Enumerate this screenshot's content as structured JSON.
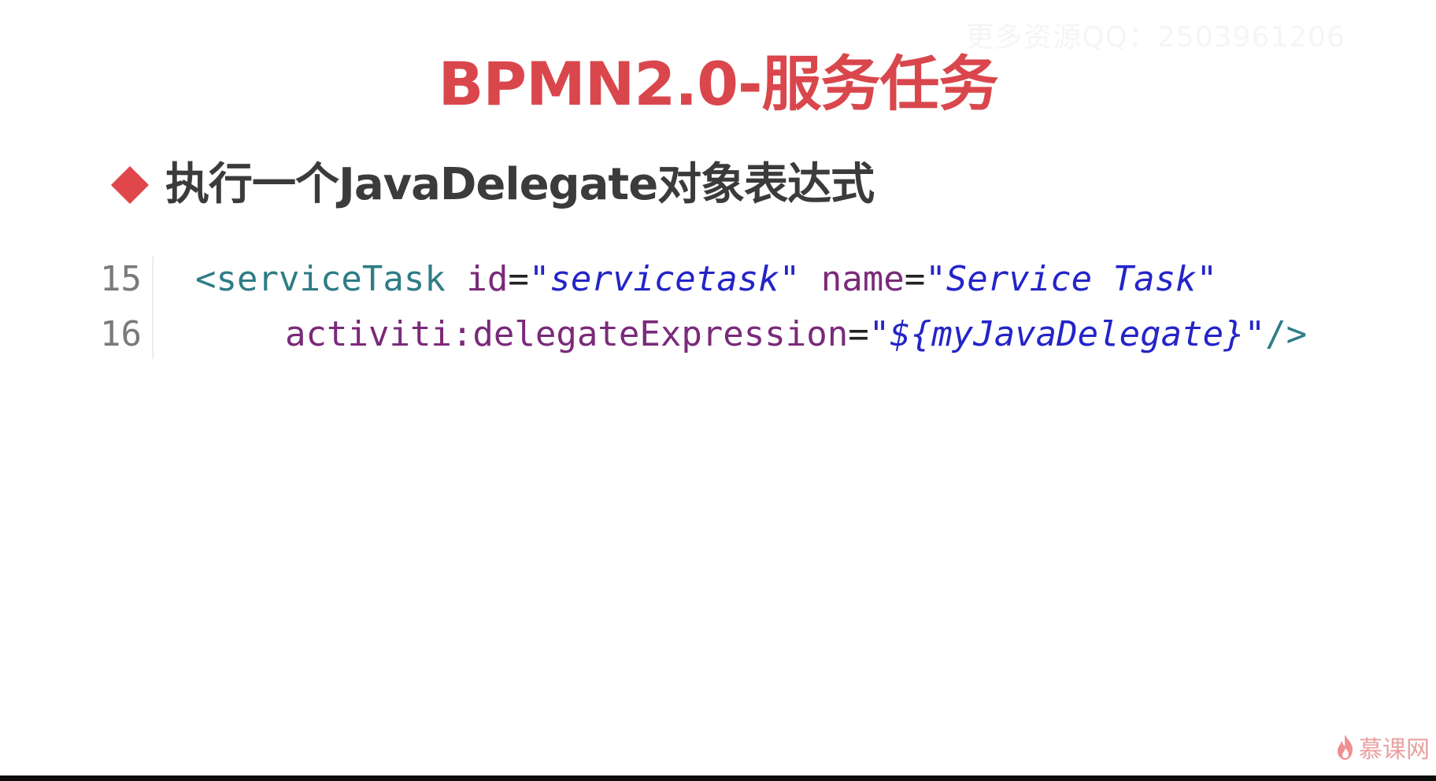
{
  "watermark": "更多资源QQ：2503961206",
  "title": "BPMN2.0-服务任务",
  "subtitle": "执行一个JavaDelegate对象表达式",
  "code": {
    "line1": {
      "number": "15",
      "tag_open": "<serviceTask",
      "attr1": "id",
      "eq1": "=",
      "val1": "\"servicetask\"",
      "attr2": "name",
      "eq2": "=",
      "val2": "\"Service Task\""
    },
    "line2": {
      "number": "16",
      "attr": "activiti:delegateExpression",
      "eq": "=",
      "val": "\"${myJavaDelegate}\"",
      "tag_close": "/>"
    }
  },
  "logo": {
    "icon": "flame-icon",
    "text": "慕课网"
  },
  "colors": {
    "title": "#d9474c",
    "bullet": "#e0474c",
    "subtitle": "#3b3b3b",
    "tag": "#2e7d86",
    "attribute": "#7a2a7a",
    "string": "#2424c8"
  }
}
